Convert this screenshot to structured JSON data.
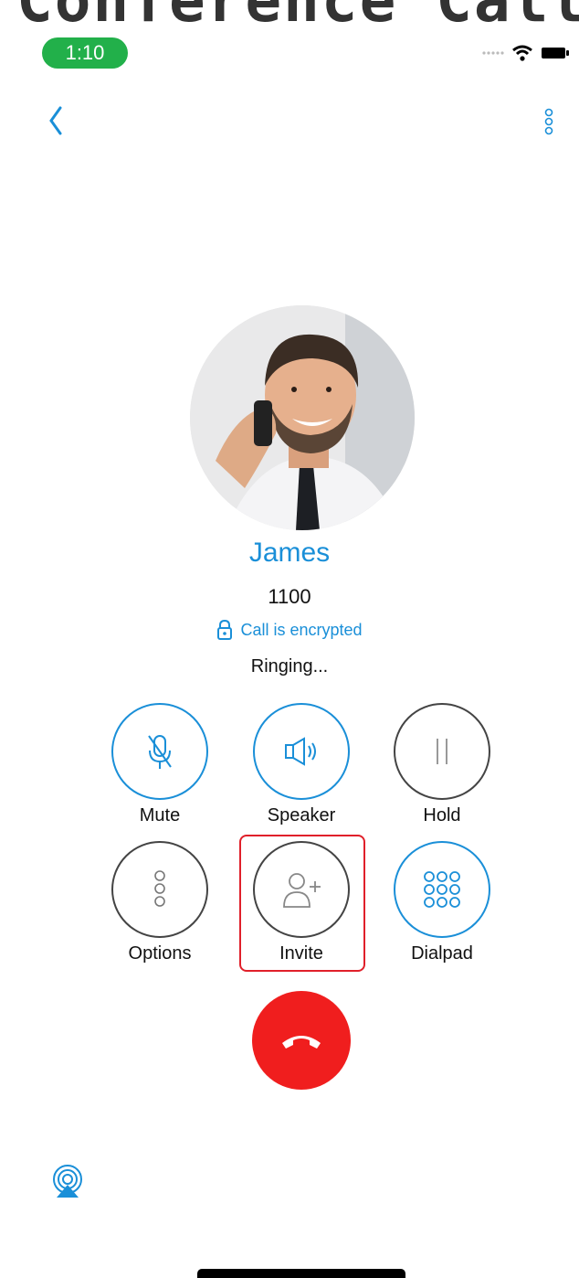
{
  "page": {
    "title": "Conference Call"
  },
  "status_bar": {
    "time": "1:10",
    "time_pill_color": "#22b04a"
  },
  "icons": {
    "back": "chevron-left-icon",
    "more": "more-vertical-icon",
    "lock": "lock-icon",
    "mute": "microphone-off-icon",
    "speaker": "speaker-icon",
    "hold": "pause-icon",
    "options": "more-vertical-icon",
    "invite": "add-person-icon",
    "dialpad": "dialpad-icon",
    "end_call": "phone-hangup-icon",
    "airplay": "airplay-icon"
  },
  "call": {
    "contact_name": "James",
    "contact_number": "1100",
    "encryption_text": "Call is encrypted",
    "status": "Ringing..."
  },
  "controls": {
    "mute": "Mute",
    "speaker": "Speaker",
    "hold": "Hold",
    "options": "Options",
    "invite": "Invite",
    "dialpad": "Dialpad"
  },
  "colors": {
    "accent": "#1a8fd8",
    "end_call": "#f01e1e",
    "highlight": "#e0202a"
  }
}
